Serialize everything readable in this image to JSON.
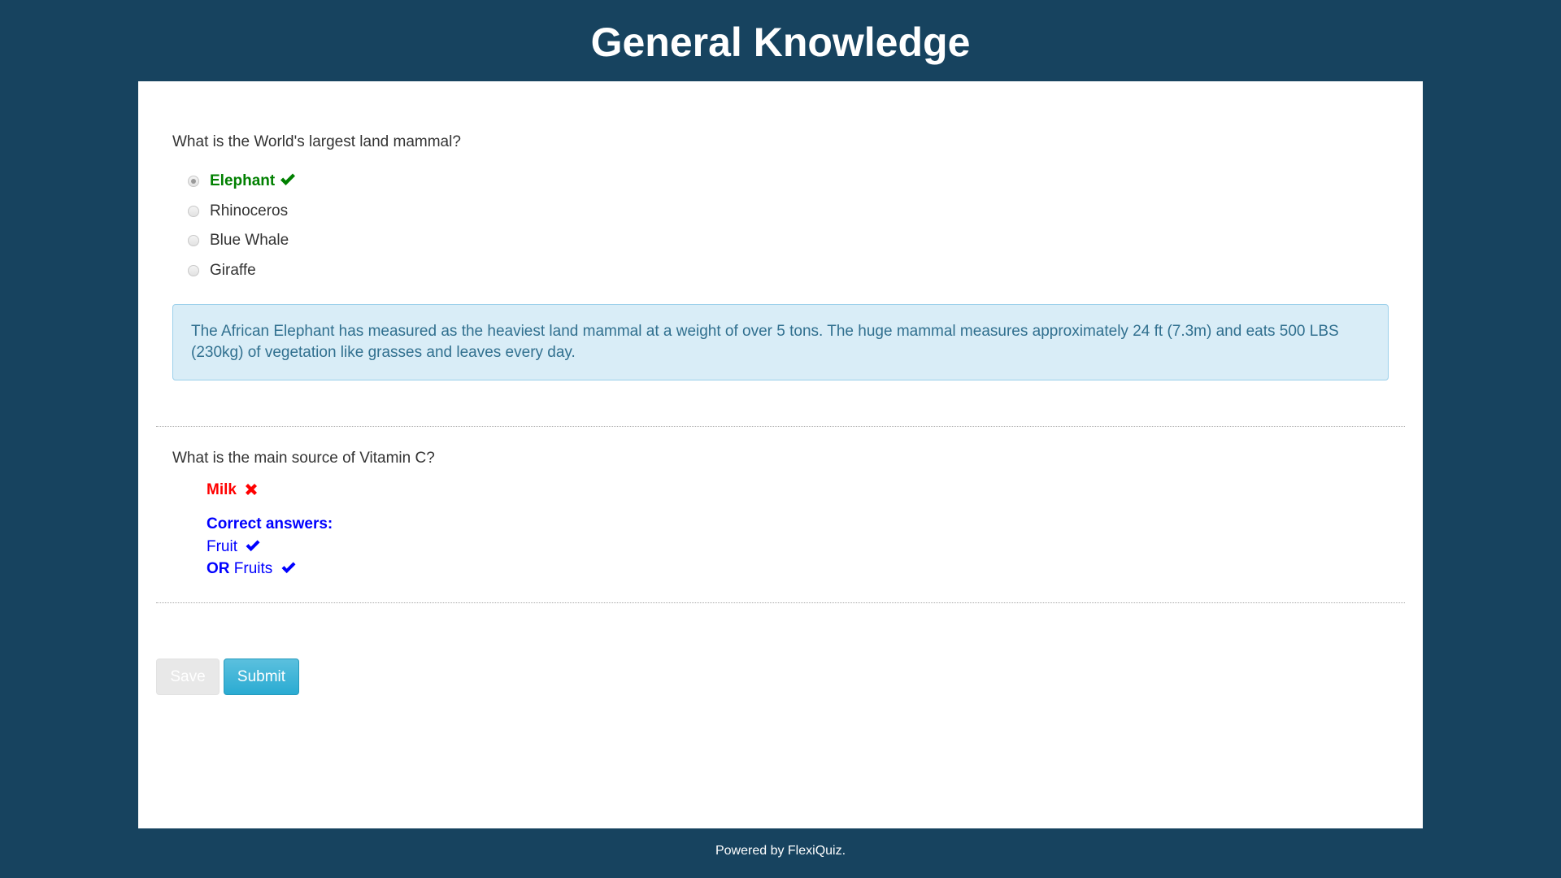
{
  "header": {
    "title": "General Knowledge"
  },
  "questions": [
    {
      "text": "What is the World's largest land mammal?",
      "options": [
        {
          "label": "Elephant",
          "selected": true,
          "status": "correct"
        },
        {
          "label": "Rhinoceros",
          "selected": false
        },
        {
          "label": "Blue Whale",
          "selected": false
        },
        {
          "label": "Giraffe",
          "selected": false
        }
      ],
      "explanation": "The African Elephant has measured as the heaviest land mammal at a weight of over 5 tons.  The huge mammal measures approximately 24 ft (7.3m) and eats 500 LBS (230kg) of vegetation like grasses and leaves every day."
    },
    {
      "text": "What is the main source of Vitamin C?",
      "user_answer": "Milk",
      "user_answer_status": "incorrect",
      "correct_answers_heading": "Correct answers:",
      "correct_answers": [
        {
          "prefix": "",
          "label": "Fruit"
        },
        {
          "prefix": "OR",
          "label": "Fruits"
        }
      ]
    }
  ],
  "actions": {
    "save_label": "Save",
    "submit_label": "Submit"
  },
  "footer": {
    "text": "Powered by FlexiQuiz."
  },
  "colors": {
    "background": "#17435f",
    "correct": "#008000",
    "incorrect": "#ff0000",
    "answer_key": "#0000ff",
    "info_bg": "#d9edf7",
    "info_text": "#31708f",
    "submit": "#31b0d5"
  }
}
